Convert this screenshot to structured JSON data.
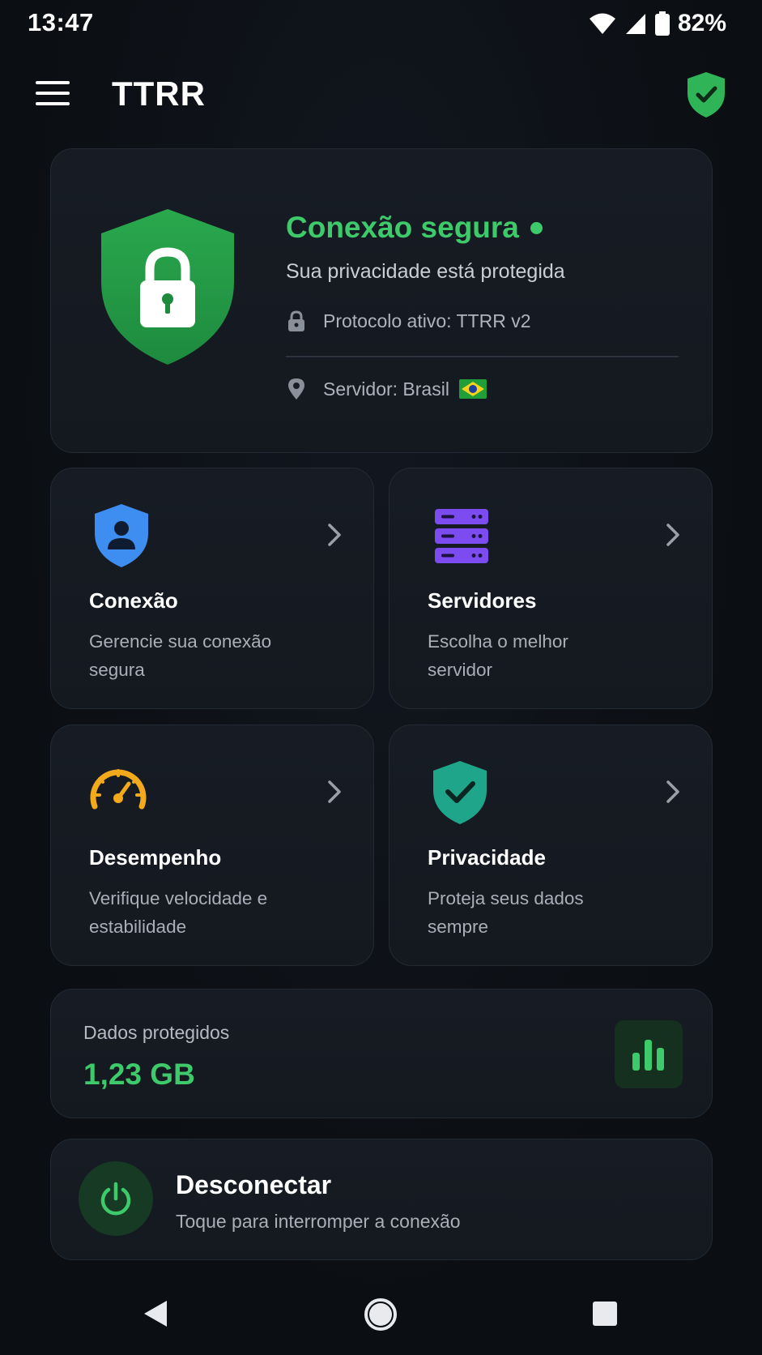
{
  "status_bar": {
    "time": "13:47",
    "battery": "82%"
  },
  "app_bar": {
    "title": "TTRR",
    "menu_icon": "menu-icon",
    "status_icon": "shield-check-icon"
  },
  "status_card": {
    "title": "Conexão segura",
    "subtitle": "Sua privacidade está protegida",
    "protocol": "Protocolo ativo: TTRR v2",
    "server": "Servidor: Brasil",
    "server_flag": "brazil-flag-icon"
  },
  "features": [
    {
      "title": "Conexão",
      "description": "Gerencie sua conexão segura",
      "icon": "user-shield-icon",
      "color": "#3d8ef0"
    },
    {
      "title": "Servidores",
      "description": "Escolha o melhor servidor",
      "icon": "server-icon",
      "color": "#7c4cf0"
    },
    {
      "title": "Desempenho",
      "description": "Verifique velocidade e estabilidade",
      "icon": "speedometer-icon",
      "color": "#f2a91b"
    },
    {
      "title": "Privacidade",
      "description": "Proteja seus dados sempre",
      "icon": "shield-check-icon",
      "color": "#1fa58a"
    }
  ],
  "data_card": {
    "label": "Dados protegidos",
    "value": "1,23 GB",
    "icon": "bar-chart-icon"
  },
  "disconnect": {
    "title": "Desconectar",
    "subtitle": "Toque para interromper a conexão",
    "icon": "power-icon"
  },
  "colors": {
    "accent_green": "#3ec96a",
    "background": "#0c0f13",
    "card": "#161b22"
  }
}
